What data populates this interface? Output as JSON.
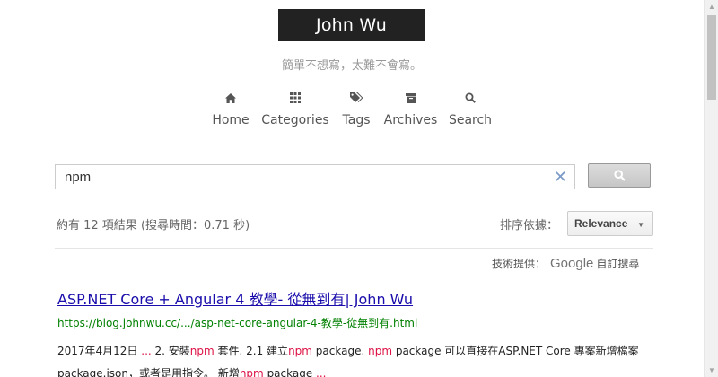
{
  "header": {
    "brand": "John Wu",
    "subtitle": "簡單不想寫，太難不會寫。"
  },
  "menu": {
    "items": [
      {
        "label": "Home",
        "icon": "home-icon"
      },
      {
        "label": "Categories",
        "icon": "grid-icon"
      },
      {
        "label": "Tags",
        "icon": "tags-icon"
      },
      {
        "label": "Archives",
        "icon": "archive-icon"
      },
      {
        "label": "Search",
        "icon": "search-icon"
      }
    ]
  },
  "search": {
    "value": "npm",
    "clear": "✕"
  },
  "results": {
    "stats": "約有 12 項結果 (搜尋時間：0.71 秒)",
    "sort_label": "排序依據：",
    "sort_value": "Relevance",
    "powered_prefix": "技術提供：",
    "powered_brand": "Google",
    "powered_suffix": "自訂搜尋",
    "items": [
      {
        "title": "ASP.NET Core + Angular 4 教學- 從無到有| John Wu",
        "url": "https://blog.johnwu.cc/.../asp-net-core-angular-4-教學-從無到有.html",
        "snippet": {
          "p1": "2017年4月12日",
          "p2": " ... ",
          "p3": "2. 安裝",
          "p4": "npm",
          "p5": " 套件. 2.1 建立",
          "p6": "npm",
          "p7": " package. ",
          "p8": "npm",
          "p9": " package 可以直接在ASP.NET Core 專案新增檔案",
          "p10": "package.json，或者是用指令。 新增",
          "p11": "npm",
          "p12": " package ",
          "p13": "..."
        }
      }
    ]
  },
  "colors": {
    "brand_bg": "#222222",
    "link": "#1a0dab",
    "url": "#008000",
    "highlight": "#dd1144"
  }
}
